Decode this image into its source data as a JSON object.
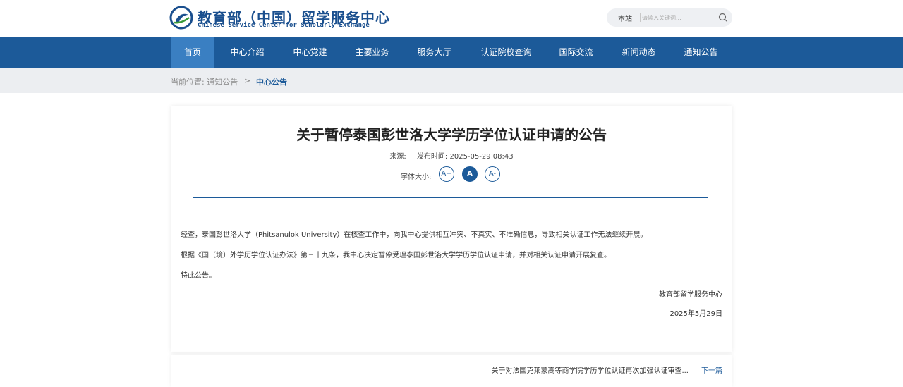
{
  "header": {
    "logo_cn": "教育部（中国）留学服务中心",
    "logo_en": "Chinese Service Center for Scholarly Exchange",
    "search": {
      "scope": "本站",
      "placeholder": "请输入关键词..."
    }
  },
  "nav": {
    "items": [
      {
        "label": "首页",
        "active": true
      },
      {
        "label": "中心介绍"
      },
      {
        "label": "中心党建"
      },
      {
        "label": "主要业务"
      },
      {
        "label": "服务大厅"
      },
      {
        "label": "认证院校查询"
      },
      {
        "label": "国际交流"
      },
      {
        "label": "新闻动态"
      },
      {
        "label": "通知公告"
      }
    ]
  },
  "breadcrumb": {
    "prefix": "当前位置: 通知公告",
    "separator": ">",
    "current": "中心公告"
  },
  "article": {
    "title": "关于暂停泰国彭世洛大学学历学位认证申请的公告",
    "source_label": "来源:",
    "published": "发布时间: 2025-05-29 08:43",
    "font_size_label": "字体大小:",
    "font_buttons": [
      "A+",
      "A",
      "A-"
    ],
    "paragraphs": [
      "经查，泰国彭世洛大学（Phitsanulok University）在核查工作中，向我中心提供相互冲突、不真实、不准确信息，导致相关认证工作无法继续开展。",
      "根据《国（境）外学历学位认证办法》第三十九条，我中心决定暂停受理泰国彭世洛大学学历学位认证申请，并对相关认证申请开展复查。",
      "特此公告。"
    ],
    "signature": "教育部留学服务中心",
    "date": "2025年5月29日"
  },
  "pager": {
    "next_title": "关于对法国克莱蒙高等商学院学历学位认证再次加强认证审查...",
    "next_label": "下一篇"
  },
  "colors": {
    "brand": "#1c5a99",
    "nav_active": "#3a7fc2"
  }
}
